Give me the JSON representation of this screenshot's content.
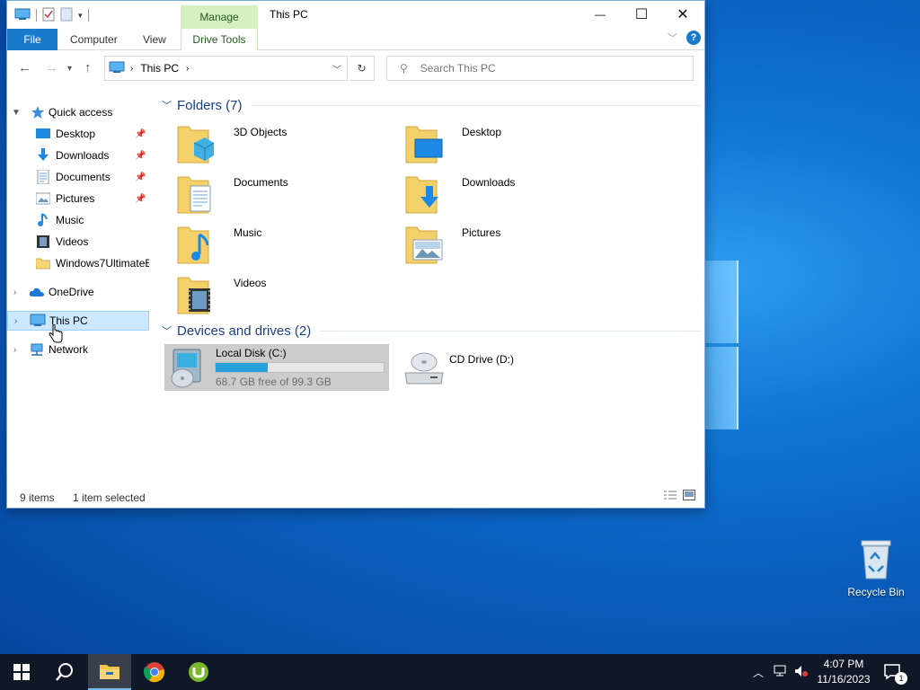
{
  "window": {
    "title": "This PC",
    "context_tab": "Manage",
    "ribbon_tabs": [
      "File",
      "Computer",
      "View",
      "Drive Tools"
    ],
    "controls": {
      "minimize": "—",
      "maximize": "☐",
      "close": "✕"
    }
  },
  "navbar": {
    "address": {
      "location": "This PC"
    },
    "search": {
      "placeholder": "Search This PC"
    }
  },
  "nav_pane": {
    "quick_access": "Quick access",
    "items": [
      {
        "label": "Desktop",
        "icon": "desktop-icon",
        "pinned": true
      },
      {
        "label": "Downloads",
        "icon": "downloads-icon",
        "pinned": true
      },
      {
        "label": "Documents",
        "icon": "documents-icon",
        "pinned": true
      },
      {
        "label": "Pictures",
        "icon": "pictures-icon",
        "pinned": true
      },
      {
        "label": "Music",
        "icon": "music-icon",
        "pinned": false
      },
      {
        "label": "Videos",
        "icon": "videos-icon",
        "pinned": false
      },
      {
        "label": "Windows7UltimateE",
        "icon": "folder-icon",
        "pinned": false
      }
    ],
    "onedrive": "OneDrive",
    "this_pc": "This PC",
    "network": "Network"
  },
  "content": {
    "folders_header": "Folders (7)",
    "folders": [
      "3D Objects",
      "Desktop",
      "Documents",
      "Downloads",
      "Music",
      "Pictures",
      "Videos"
    ],
    "drives_header": "Devices and drives (2)",
    "drives": [
      {
        "name": "Local Disk (C:)",
        "free_text": "68.7 GB free of 99.3 GB",
        "used_fraction": 0.31,
        "selected": true
      },
      {
        "name": "CD Drive (D:)"
      }
    ]
  },
  "status": {
    "item_count": "9 items",
    "selection": "1 item selected"
  },
  "desktop": {
    "recycle_bin": "Recycle Bin"
  },
  "taskbar": {
    "time": "4:07 PM",
    "date": "11/16/2023",
    "notification_count": "1"
  },
  "colors": {
    "accent": "#1979ca",
    "manage_tab": "#d5f1c1",
    "selection": "#cce8ff",
    "progress": "#26a0da",
    "taskbar": "#101827"
  }
}
